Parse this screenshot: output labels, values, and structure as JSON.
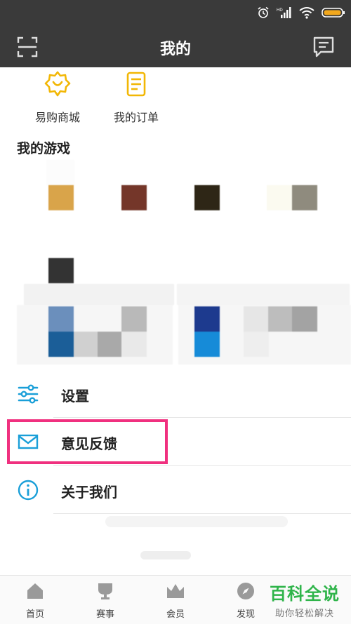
{
  "header": {
    "title": "我的"
  },
  "shortcuts": [
    {
      "label": "易购商城"
    },
    {
      "label": "我的订单"
    }
  ],
  "games_section": {
    "title": "我的游戏"
  },
  "menu": {
    "items": [
      {
        "label": "设置",
        "icon": "sliders-icon"
      },
      {
        "label": "意见反馈",
        "icon": "mail-icon"
      },
      {
        "label": "关于我们",
        "icon": "info-icon"
      }
    ]
  },
  "tabs": [
    {
      "label": "首页"
    },
    {
      "label": "赛事"
    },
    {
      "label": "会员"
    },
    {
      "label": "发现"
    }
  ],
  "watermark": {
    "main": "百科全说",
    "sub": "助你轻松解决"
  },
  "colors": {
    "header_bg": "#3a3a3a",
    "accent_blue": "#1a9fd8",
    "accent_yellow": "#f2b705",
    "highlight_pink": "#f0307f",
    "watermark_green": "#2fb44a"
  }
}
